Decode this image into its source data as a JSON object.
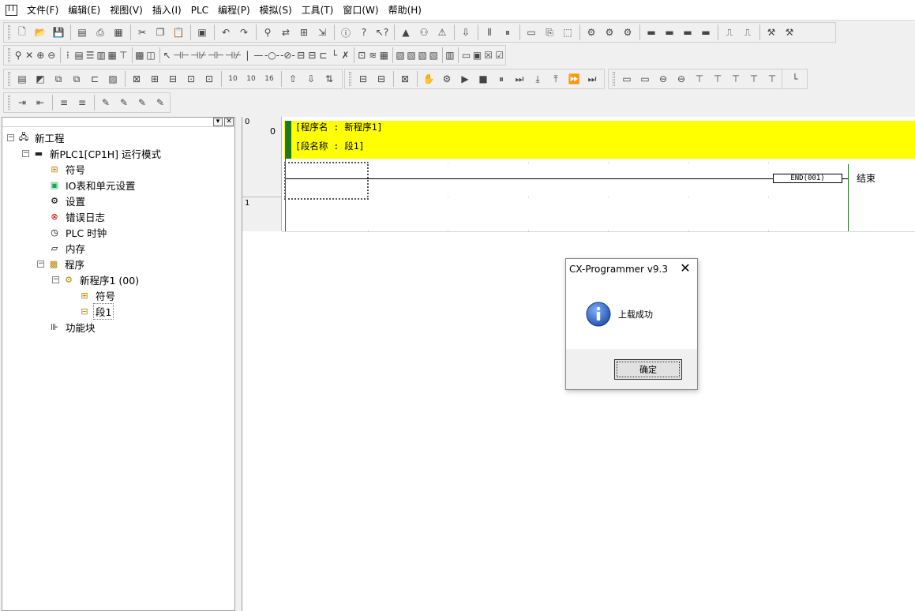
{
  "menu": [
    "文件(F)",
    "编辑(E)",
    "视图(V)",
    "插入(I)",
    "PLC",
    "编程(P)",
    "模拟(S)",
    "工具(T)",
    "窗口(W)",
    "帮助(H)"
  ],
  "tree": {
    "project": "新工程",
    "plc": "新PLC1[CP1H] 运行模式",
    "symbols": "符号",
    "io_table": "IO表和单元设置",
    "settings": "设置",
    "error_log": "错误日志",
    "plc_clock": "PLC 时钟",
    "memory": "内存",
    "programs": "程序",
    "program1": "新程序1 (00)",
    "program_symbols": "符号",
    "section1": "段1",
    "function_blocks": "功能块"
  },
  "ladder": {
    "rung0_number": "0",
    "rung0_step": "0",
    "rung1_number": "1",
    "program_name": "[程序名 : 新程序1]",
    "section_name": "[段名称 : 段1]",
    "end_instruction": "END(001)",
    "end_comment": "结束"
  },
  "dialog": {
    "title": "CX-Programmer v9.3",
    "close": "✕",
    "message": "上载成功",
    "ok_label": "确定"
  },
  "colors": {
    "section_band": "#ffff00",
    "rail": "#1f7a1f",
    "info_icon": "#1f5fbf"
  }
}
